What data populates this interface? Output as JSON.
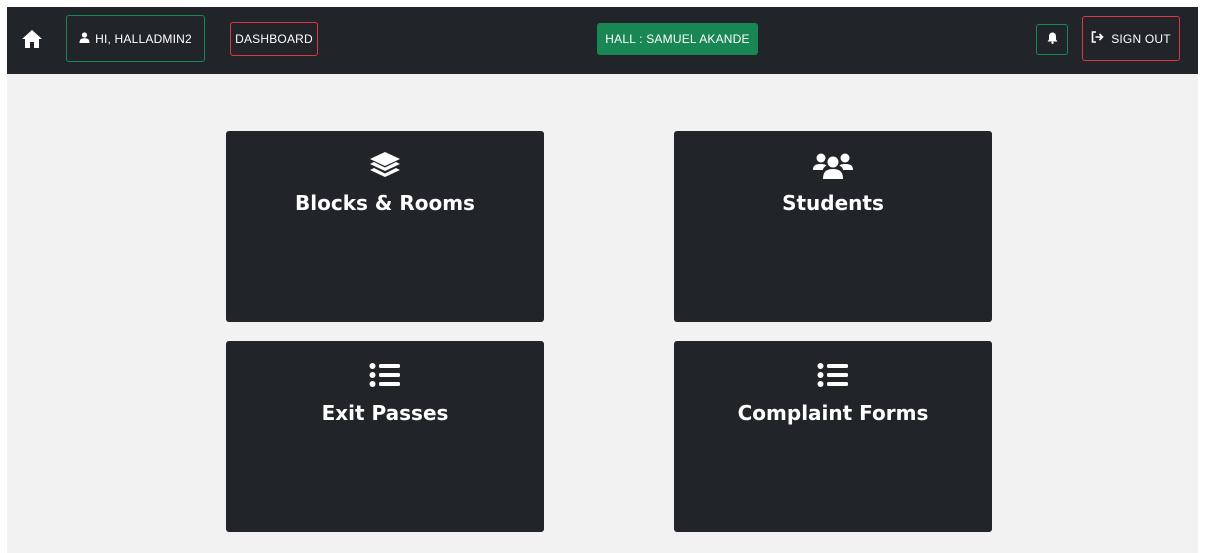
{
  "navbar": {
    "user_label": "HI, HALLADMIN2",
    "dashboard_label": "DASHBOARD",
    "hall_label": "HALL : SAMUEL AKANDE",
    "signout_label": "SIGN OUT"
  },
  "cards": [
    {
      "title": "Blocks & Rooms",
      "icon": "layers-icon"
    },
    {
      "title": "Students",
      "icon": "users-icon"
    },
    {
      "title": "Exit Passes",
      "icon": "list-icon"
    },
    {
      "title": "Complaint Forms",
      "icon": "list-icon"
    }
  ],
  "colors": {
    "navbar_bg": "#212529",
    "card_bg": "#212529",
    "page_bg": "#f2f2f2",
    "success": "#198754",
    "danger": "#dc3545"
  }
}
